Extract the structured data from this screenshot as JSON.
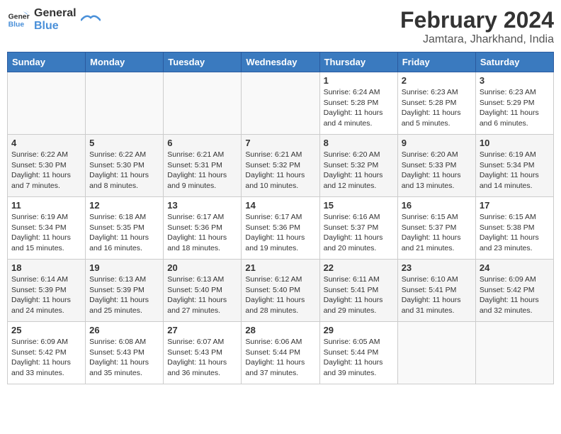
{
  "logo": {
    "line1": "General",
    "line2": "Blue"
  },
  "title": "February 2024",
  "location": "Jamtara, Jharkhand, India",
  "weekdays": [
    "Sunday",
    "Monday",
    "Tuesday",
    "Wednesday",
    "Thursday",
    "Friday",
    "Saturday"
  ],
  "weeks": [
    [
      {
        "day": "",
        "info": ""
      },
      {
        "day": "",
        "info": ""
      },
      {
        "day": "",
        "info": ""
      },
      {
        "day": "",
        "info": ""
      },
      {
        "day": "1",
        "info": "Sunrise: 6:24 AM\nSunset: 5:28 PM\nDaylight: 11 hours\nand 4 minutes."
      },
      {
        "day": "2",
        "info": "Sunrise: 6:23 AM\nSunset: 5:28 PM\nDaylight: 11 hours\nand 5 minutes."
      },
      {
        "day": "3",
        "info": "Sunrise: 6:23 AM\nSunset: 5:29 PM\nDaylight: 11 hours\nand 6 minutes."
      }
    ],
    [
      {
        "day": "4",
        "info": "Sunrise: 6:22 AM\nSunset: 5:30 PM\nDaylight: 11 hours\nand 7 minutes."
      },
      {
        "day": "5",
        "info": "Sunrise: 6:22 AM\nSunset: 5:30 PM\nDaylight: 11 hours\nand 8 minutes."
      },
      {
        "day": "6",
        "info": "Sunrise: 6:21 AM\nSunset: 5:31 PM\nDaylight: 11 hours\nand 9 minutes."
      },
      {
        "day": "7",
        "info": "Sunrise: 6:21 AM\nSunset: 5:32 PM\nDaylight: 11 hours\nand 10 minutes."
      },
      {
        "day": "8",
        "info": "Sunrise: 6:20 AM\nSunset: 5:32 PM\nDaylight: 11 hours\nand 12 minutes."
      },
      {
        "day": "9",
        "info": "Sunrise: 6:20 AM\nSunset: 5:33 PM\nDaylight: 11 hours\nand 13 minutes."
      },
      {
        "day": "10",
        "info": "Sunrise: 6:19 AM\nSunset: 5:34 PM\nDaylight: 11 hours\nand 14 minutes."
      }
    ],
    [
      {
        "day": "11",
        "info": "Sunrise: 6:19 AM\nSunset: 5:34 PM\nDaylight: 11 hours\nand 15 minutes."
      },
      {
        "day": "12",
        "info": "Sunrise: 6:18 AM\nSunset: 5:35 PM\nDaylight: 11 hours\nand 16 minutes."
      },
      {
        "day": "13",
        "info": "Sunrise: 6:17 AM\nSunset: 5:36 PM\nDaylight: 11 hours\nand 18 minutes."
      },
      {
        "day": "14",
        "info": "Sunrise: 6:17 AM\nSunset: 5:36 PM\nDaylight: 11 hours\nand 19 minutes."
      },
      {
        "day": "15",
        "info": "Sunrise: 6:16 AM\nSunset: 5:37 PM\nDaylight: 11 hours\nand 20 minutes."
      },
      {
        "day": "16",
        "info": "Sunrise: 6:15 AM\nSunset: 5:37 PM\nDaylight: 11 hours\nand 21 minutes."
      },
      {
        "day": "17",
        "info": "Sunrise: 6:15 AM\nSunset: 5:38 PM\nDaylight: 11 hours\nand 23 minutes."
      }
    ],
    [
      {
        "day": "18",
        "info": "Sunrise: 6:14 AM\nSunset: 5:39 PM\nDaylight: 11 hours\nand 24 minutes."
      },
      {
        "day": "19",
        "info": "Sunrise: 6:13 AM\nSunset: 5:39 PM\nDaylight: 11 hours\nand 25 minutes."
      },
      {
        "day": "20",
        "info": "Sunrise: 6:13 AM\nSunset: 5:40 PM\nDaylight: 11 hours\nand 27 minutes."
      },
      {
        "day": "21",
        "info": "Sunrise: 6:12 AM\nSunset: 5:40 PM\nDaylight: 11 hours\nand 28 minutes."
      },
      {
        "day": "22",
        "info": "Sunrise: 6:11 AM\nSunset: 5:41 PM\nDaylight: 11 hours\nand 29 minutes."
      },
      {
        "day": "23",
        "info": "Sunrise: 6:10 AM\nSunset: 5:41 PM\nDaylight: 11 hours\nand 31 minutes."
      },
      {
        "day": "24",
        "info": "Sunrise: 6:09 AM\nSunset: 5:42 PM\nDaylight: 11 hours\nand 32 minutes."
      }
    ],
    [
      {
        "day": "25",
        "info": "Sunrise: 6:09 AM\nSunset: 5:42 PM\nDaylight: 11 hours\nand 33 minutes."
      },
      {
        "day": "26",
        "info": "Sunrise: 6:08 AM\nSunset: 5:43 PM\nDaylight: 11 hours\nand 35 minutes."
      },
      {
        "day": "27",
        "info": "Sunrise: 6:07 AM\nSunset: 5:43 PM\nDaylight: 11 hours\nand 36 minutes."
      },
      {
        "day": "28",
        "info": "Sunrise: 6:06 AM\nSunset: 5:44 PM\nDaylight: 11 hours\nand 37 minutes."
      },
      {
        "day": "29",
        "info": "Sunrise: 6:05 AM\nSunset: 5:44 PM\nDaylight: 11 hours\nand 39 minutes."
      },
      {
        "day": "",
        "info": ""
      },
      {
        "day": "",
        "info": ""
      }
    ]
  ]
}
